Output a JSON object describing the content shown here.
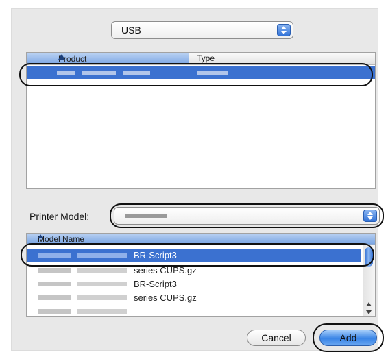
{
  "connection_popup": {
    "value": "USB"
  },
  "device_list": {
    "columns": [
      {
        "label": "Product"
      },
      {
        "label": "Type"
      }
    ]
  },
  "printer_model": {
    "label": "Printer Model:"
  },
  "model_list": {
    "header": "Model Name",
    "rows": [
      {
        "text": "BR-Script3"
      },
      {
        "text": "series CUPS.gz"
      },
      {
        "text": "BR-Script3"
      },
      {
        "text": "series CUPS.gz"
      }
    ]
  },
  "buttons": {
    "cancel": "Cancel",
    "add": "Add"
  },
  "colors": {
    "selection": "#3b71d0",
    "accent": "#2d6fd6",
    "panel": "#e8e8e8"
  }
}
